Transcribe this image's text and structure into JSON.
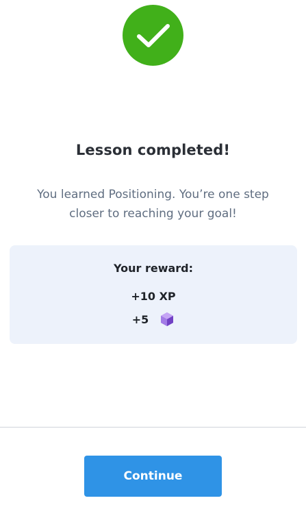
{
  "header": {
    "status_icon": "checkmark-icon",
    "status_color": "#41b01a"
  },
  "lesson": {
    "title": "Lesson completed!",
    "message": "You learned Positioning. You’re one step closer to reaching your goal!"
  },
  "reward": {
    "heading": "Your reward:",
    "xp": "+10 XP",
    "gems": "+5",
    "gem_icon": "purple-gem-icon",
    "card_color": "#edf2fb"
  },
  "footer": {
    "continue_label": "Continue",
    "button_color": "#2f93e6"
  }
}
